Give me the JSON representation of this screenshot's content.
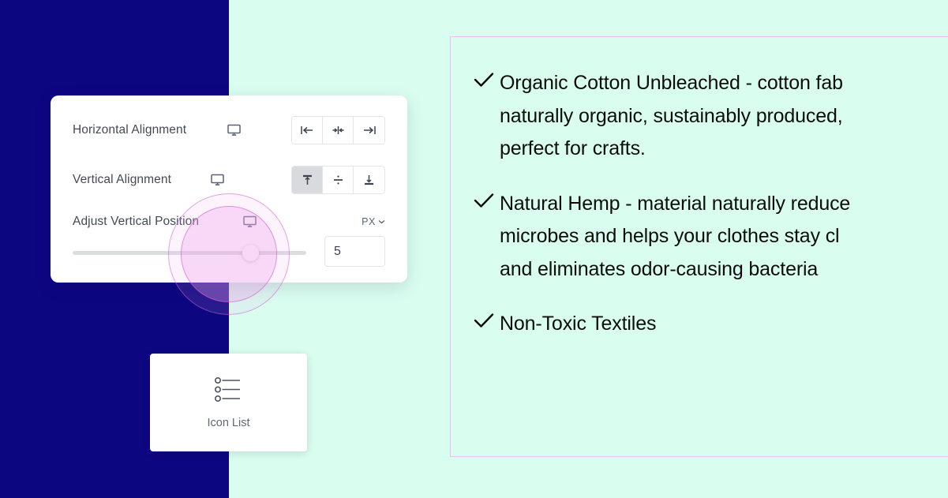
{
  "theme": {
    "left_bg": "#0d0681",
    "right_bg": "#d9fdef",
    "panel_border": "#edbdee",
    "ripple_accent": "#d05ed0",
    "label_color": "#434a54",
    "active_segment_bg": "#d8dadd"
  },
  "settings_panel": {
    "rows": [
      {
        "label": "Horizontal Alignment",
        "device_icon": "desktop-monitor-icon",
        "control": "segmented-alignment",
        "options": [
          {
            "name": "align-left-icon",
            "active": false
          },
          {
            "name": "align-center-icon",
            "active": false
          },
          {
            "name": "align-right-icon",
            "active": false
          }
        ]
      },
      {
        "label": "Vertical Alignment",
        "device_icon": "desktop-monitor-icon",
        "control": "segmented-alignment",
        "options": [
          {
            "name": "align-top-icon",
            "active": true
          },
          {
            "name": "align-middle-icon",
            "active": false
          },
          {
            "name": "align-bottom-icon",
            "active": false
          }
        ]
      },
      {
        "label": "Adjust Vertical Position",
        "device_icon": "desktop-monitor-icon",
        "control": "slider",
        "unit_label": "PX",
        "unit_chevron": "chevron-down-icon",
        "slider_value": "5",
        "slider_percent": 73
      }
    ]
  },
  "widget_card": {
    "icon": "icon-list-icon",
    "label": "Icon List"
  },
  "features_panel": {
    "items": [
      {
        "icon": "check-icon",
        "text": "Organic Cotton Unbleached - cotton fab\nnaturally organic, sustainably produced,\nperfect for crafts."
      },
      {
        "icon": "check-icon",
        "text": "Natural Hemp - material naturally reduce\nmicrobes and helps your clothes stay cl\nand eliminates odor-causing bacteria"
      },
      {
        "icon": "check-icon",
        "text": "Non-Toxic Textiles"
      }
    ]
  }
}
